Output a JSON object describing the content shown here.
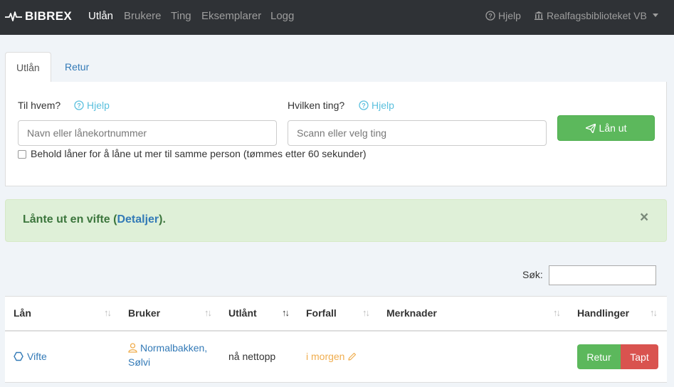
{
  "navbar": {
    "brand": "BIBREX",
    "links": [
      "Utlån",
      "Brukere",
      "Ting",
      "Eksemplarer",
      "Logg"
    ],
    "help": "Hjelp",
    "library": "Realfagsbiblioteket VB"
  },
  "tabs": [
    "Utlån",
    "Retur"
  ],
  "form": {
    "to_whom_label": "Til hvem?",
    "help_label": "Hjelp",
    "user_placeholder": "Navn eller lånekortnummer",
    "thing_label": "Hvilken ting?",
    "thing_placeholder": "Scann eller velg ting",
    "lend_button": "Lån ut",
    "keep_label": "Behold låner for å låne ut mer til samme person (tømmes etter 60 sekunder)"
  },
  "alert": {
    "prefix": "Lånte ut en vifte (",
    "link": "Detaljer",
    "suffix": ").",
    "close": "×"
  },
  "search": {
    "label": "Søk:"
  },
  "table": {
    "headers": [
      "Lån",
      "Bruker",
      "Utlånt",
      "Forfall",
      "Merknader",
      "Handlinger"
    ],
    "sorted_column": "Utlånt",
    "rows": [
      {
        "item": "Vifte",
        "user_line1": "Normalbakken,",
        "user_line2": "Sølvi",
        "lent": "nå nettopp",
        "due": "i morgen",
        "notes": "",
        "return_button": "Retur",
        "lost_button": "Tapt"
      }
    ]
  },
  "colors": {
    "navbar": "#2f3236",
    "success": "#5cb85c",
    "danger": "#d9534f",
    "link": "#337ab7",
    "info": "#5bc0de",
    "warning": "#f0ad4e",
    "alert_bg": "#dff0d8",
    "alert_text": "#3c763d"
  },
  "icons": {
    "brand": "heartbeat-icon",
    "help": "question-circle-icon",
    "library": "institution-icon",
    "dropdown": "caret-down-icon",
    "send": "paper-plane-icon",
    "item": "hexagon-icon",
    "user": "user-icon",
    "edit": "pencil-icon"
  }
}
